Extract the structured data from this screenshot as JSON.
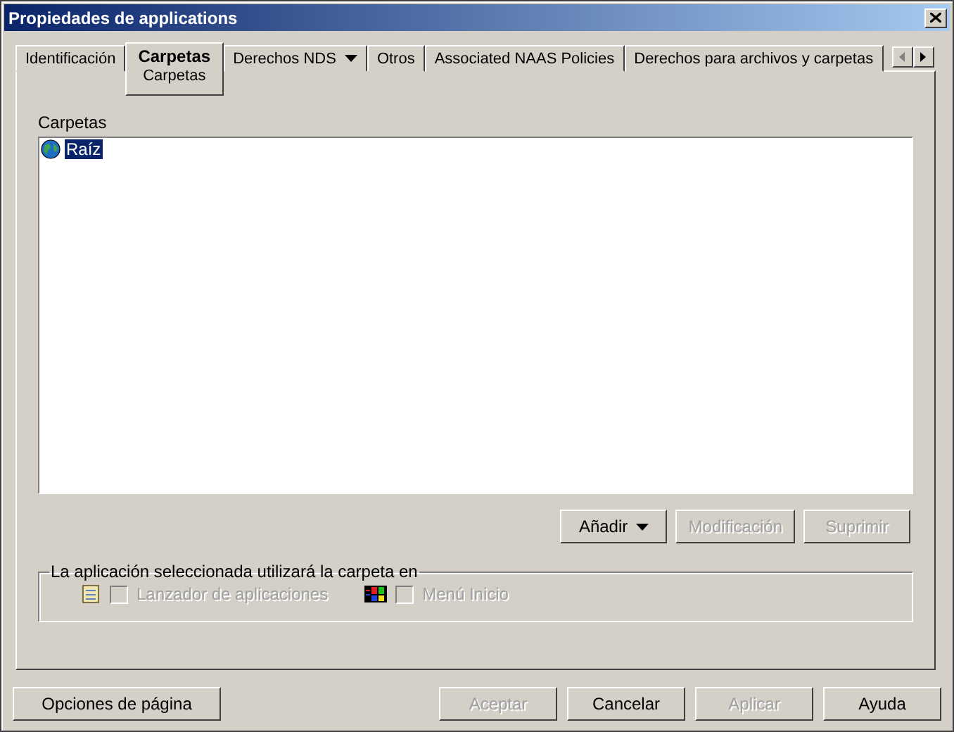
{
  "window": {
    "title": "Propiedades de applications"
  },
  "tabs": [
    {
      "label": "Identificación",
      "selected": false,
      "dropdown": false
    },
    {
      "label": "Carpetas",
      "selected": true,
      "dropdown": false,
      "sublabel": "Carpetas"
    },
    {
      "label": "Derechos NDS",
      "selected": false,
      "dropdown": true
    },
    {
      "label": "Otros",
      "selected": false,
      "dropdown": false
    },
    {
      "label": "Associated NAAS Policies",
      "selected": false,
      "dropdown": false
    },
    {
      "label": "Derechos para archivos y carpetas",
      "selected": false,
      "dropdown": false
    }
  ],
  "folders": {
    "label": "Carpetas",
    "items": [
      {
        "label": "Raíz",
        "selected": true
      }
    ]
  },
  "actions": [
    {
      "label": "Añadir",
      "disabled": false,
      "dropdown": true
    },
    {
      "label": "Modificación",
      "disabled": true,
      "dropdown": false
    },
    {
      "label": "Suprimir",
      "disabled": true,
      "dropdown": false
    }
  ],
  "group": {
    "title": "La aplicación seleccionada utilizará la carpeta en",
    "options": [
      {
        "kind": "launcher",
        "label": "Lanzador de aplicaciones",
        "checked": false,
        "disabled": true
      },
      {
        "kind": "start",
        "label": "Menú Inicio",
        "checked": false,
        "disabled": true
      }
    ]
  },
  "footer": {
    "left": {
      "label": "Opciones de página",
      "disabled": false
    },
    "right": [
      {
        "label": "Aceptar",
        "disabled": true
      },
      {
        "label": "Cancelar",
        "disabled": false
      },
      {
        "label": "Aplicar",
        "disabled": true
      },
      {
        "label": "Ayuda",
        "disabled": false
      }
    ]
  }
}
